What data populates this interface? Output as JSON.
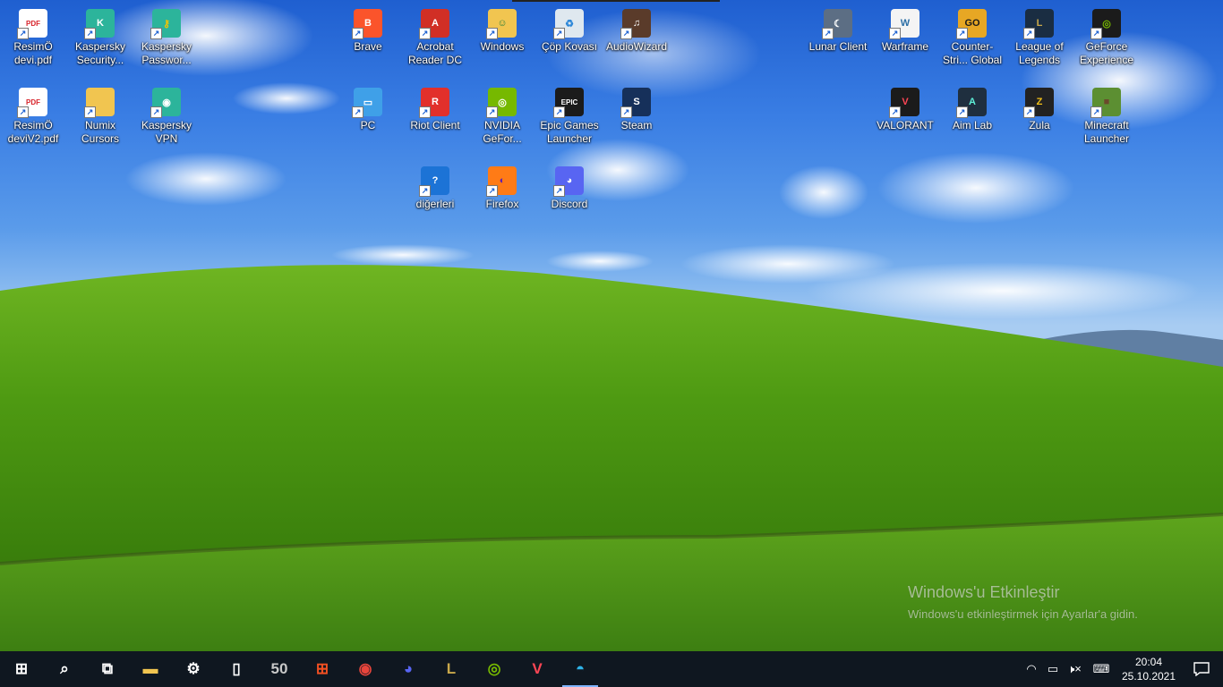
{
  "desktop": {
    "icons": [
      {
        "label": "ResimÖ devi.pdf",
        "icon": "pdf-icon",
        "color": "#ffffff",
        "fg": "#d8242b",
        "glyph": "PDF"
      },
      {
        "label": "Kaspersky Security...",
        "icon": "kaspersky-security-icon",
        "color": "#2cb49b",
        "fg": "#ffffff",
        "glyph": "K"
      },
      {
        "label": "Kaspersky Passwor...",
        "icon": "kaspersky-password-icon",
        "color": "#2cb49b",
        "fg": "#f5c400",
        "glyph": "⚷"
      },
      {
        "label": "ResimÖ deviV2.pdf",
        "icon": "pdf-icon",
        "color": "#ffffff",
        "fg": "#d8242b",
        "glyph": "PDF"
      },
      {
        "label": "Numix Cursors",
        "icon": "folder-icon",
        "color": "#f1c550",
        "fg": "#8a6a12",
        "glyph": ""
      },
      {
        "label": "Kaspersky VPN",
        "icon": "kaspersky-vpn-icon",
        "color": "#2cb49b",
        "fg": "#ffffff",
        "glyph": "◉"
      },
      {
        "label": "Brave",
        "icon": "brave-icon",
        "color": "#fb542b",
        "fg": "#ffffff",
        "glyph": "B"
      },
      {
        "label": "Acrobat Reader DC",
        "icon": "acrobat-icon",
        "color": "#d12f25",
        "fg": "#ffffff",
        "glyph": "A"
      },
      {
        "label": "Windows",
        "icon": "user-folder-icon",
        "color": "#f1c550",
        "fg": "#2a7f3b",
        "glyph": "☺"
      },
      {
        "label": "Çöp Kovası",
        "icon": "recycle-bin-icon",
        "color": "#dfe8ef",
        "fg": "#2b86d8",
        "glyph": "♻"
      },
      {
        "label": "AudioWizard",
        "icon": "audiowizard-icon",
        "color": "#5a3b2a",
        "fg": "#ffffff",
        "glyph": "♫"
      },
      {
        "label": "PC",
        "icon": "computer-icon",
        "color": "#3fa0e8",
        "fg": "#ffffff",
        "glyph": "▭"
      },
      {
        "label": "Riot Client",
        "icon": "riot-client-icon",
        "color": "#e2302b",
        "fg": "#ffffff",
        "glyph": "R"
      },
      {
        "label": "NVIDIA GeFor...",
        "icon": "nvidia-icon",
        "color": "#76b900",
        "fg": "#ffffff",
        "glyph": "◎"
      },
      {
        "label": "Epic Games Launcher",
        "icon": "epic-games-icon",
        "color": "#1b1b1b",
        "fg": "#ffffff",
        "glyph": "EPIC"
      },
      {
        "label": "Steam",
        "icon": "steam-icon",
        "color": "#16305a",
        "fg": "#ffffff",
        "glyph": "S"
      },
      {
        "label": "diğerleri",
        "icon": "help-icon",
        "color": "#1c73d6",
        "fg": "#ffffff",
        "glyph": "?"
      },
      {
        "label": "Firefox",
        "icon": "firefox-icon",
        "color": "#ff7b16",
        "fg": "#5a1db5",
        "glyph": "◐"
      },
      {
        "label": "Discord",
        "icon": "discord-icon",
        "color": "#5865f2",
        "fg": "#ffffff",
        "glyph": "◕"
      },
      {
        "label": "Lunar Client",
        "icon": "lunar-client-icon",
        "color": "#5c6e84",
        "fg": "#ffffff",
        "glyph": "☾"
      },
      {
        "label": "Warframe",
        "icon": "warframe-icon",
        "color": "#f4f4f4",
        "fg": "#2c6fa6",
        "glyph": "W"
      },
      {
        "label": "Counter-Stri... Global Offe...",
        "icon": "csgo-icon",
        "color": "#e7a724",
        "fg": "#1a1a1a",
        "glyph": "GO"
      },
      {
        "label": "League of Legends",
        "icon": "league-icon",
        "color": "#1a2d42",
        "fg": "#c9a84b",
        "glyph": "L"
      },
      {
        "label": "GeForce Experience",
        "icon": "geforce-experience-icon",
        "color": "#1b1b1b",
        "fg": "#76b900",
        "glyph": "◎"
      },
      {
        "label": "VALORANT",
        "icon": "valorant-icon",
        "color": "#1b1b1b",
        "fg": "#ff4655",
        "glyph": "V"
      },
      {
        "label": "Aim Lab",
        "icon": "aim-lab-icon",
        "color": "#1f2f3f",
        "fg": "#5ef0d8",
        "glyph": "A"
      },
      {
        "label": "Zula",
        "icon": "zula-icon",
        "color": "#222222",
        "fg": "#f2c019",
        "glyph": "Z"
      },
      {
        "label": "Minecraft Launcher",
        "icon": "minecraft-icon",
        "color": "#5c8f32",
        "fg": "#6b4a2b",
        "glyph": "■"
      }
    ]
  },
  "watermark": {
    "title": "Windows'u Etkinleştir",
    "subtitle": "Windows'u etkinleştirmek için Ayarlar'a gidin."
  },
  "taskbar": {
    "items": [
      {
        "name": "start-icon",
        "glyph": "⊞",
        "color": "#ffffff"
      },
      {
        "name": "search-icon",
        "glyph": "⌕",
        "color": "#ffffff"
      },
      {
        "name": "task-view-icon",
        "glyph": "⧉",
        "color": "#ffffff"
      },
      {
        "name": "file-explorer-icon",
        "glyph": "▬",
        "color": "#f1c550"
      },
      {
        "name": "settings-gear-icon",
        "glyph": "⚙",
        "color": "#ffffff"
      },
      {
        "name": "notepad-icon",
        "glyph": "▯",
        "color": "#ffffff"
      },
      {
        "name": "hwmonitor-icon",
        "glyph": "50",
        "color": "#c8c8c8"
      },
      {
        "name": "microsoft-store-icon",
        "glyph": "⊞",
        "color": "#f25022"
      },
      {
        "name": "chrome-icon",
        "glyph": "◉",
        "color": "#e8453c"
      },
      {
        "name": "discord-icon",
        "glyph": "◕",
        "color": "#5865f2"
      },
      {
        "name": "league-icon",
        "glyph": "L",
        "color": "#c9a84b"
      },
      {
        "name": "nvidia-icon",
        "glyph": "◎",
        "color": "#76b900"
      },
      {
        "name": "valorant-icon",
        "glyph": "V",
        "color": "#ff4655"
      },
      {
        "name": "edge-icon",
        "glyph": "◓",
        "color": "#2fb3e8"
      }
    ],
    "tray": {
      "wifi": "◠",
      "battery": "▭",
      "volume": "🕨×",
      "keyboard": "⌨"
    },
    "clock": {
      "time": "20:04",
      "date": "25.10.2021"
    }
  }
}
